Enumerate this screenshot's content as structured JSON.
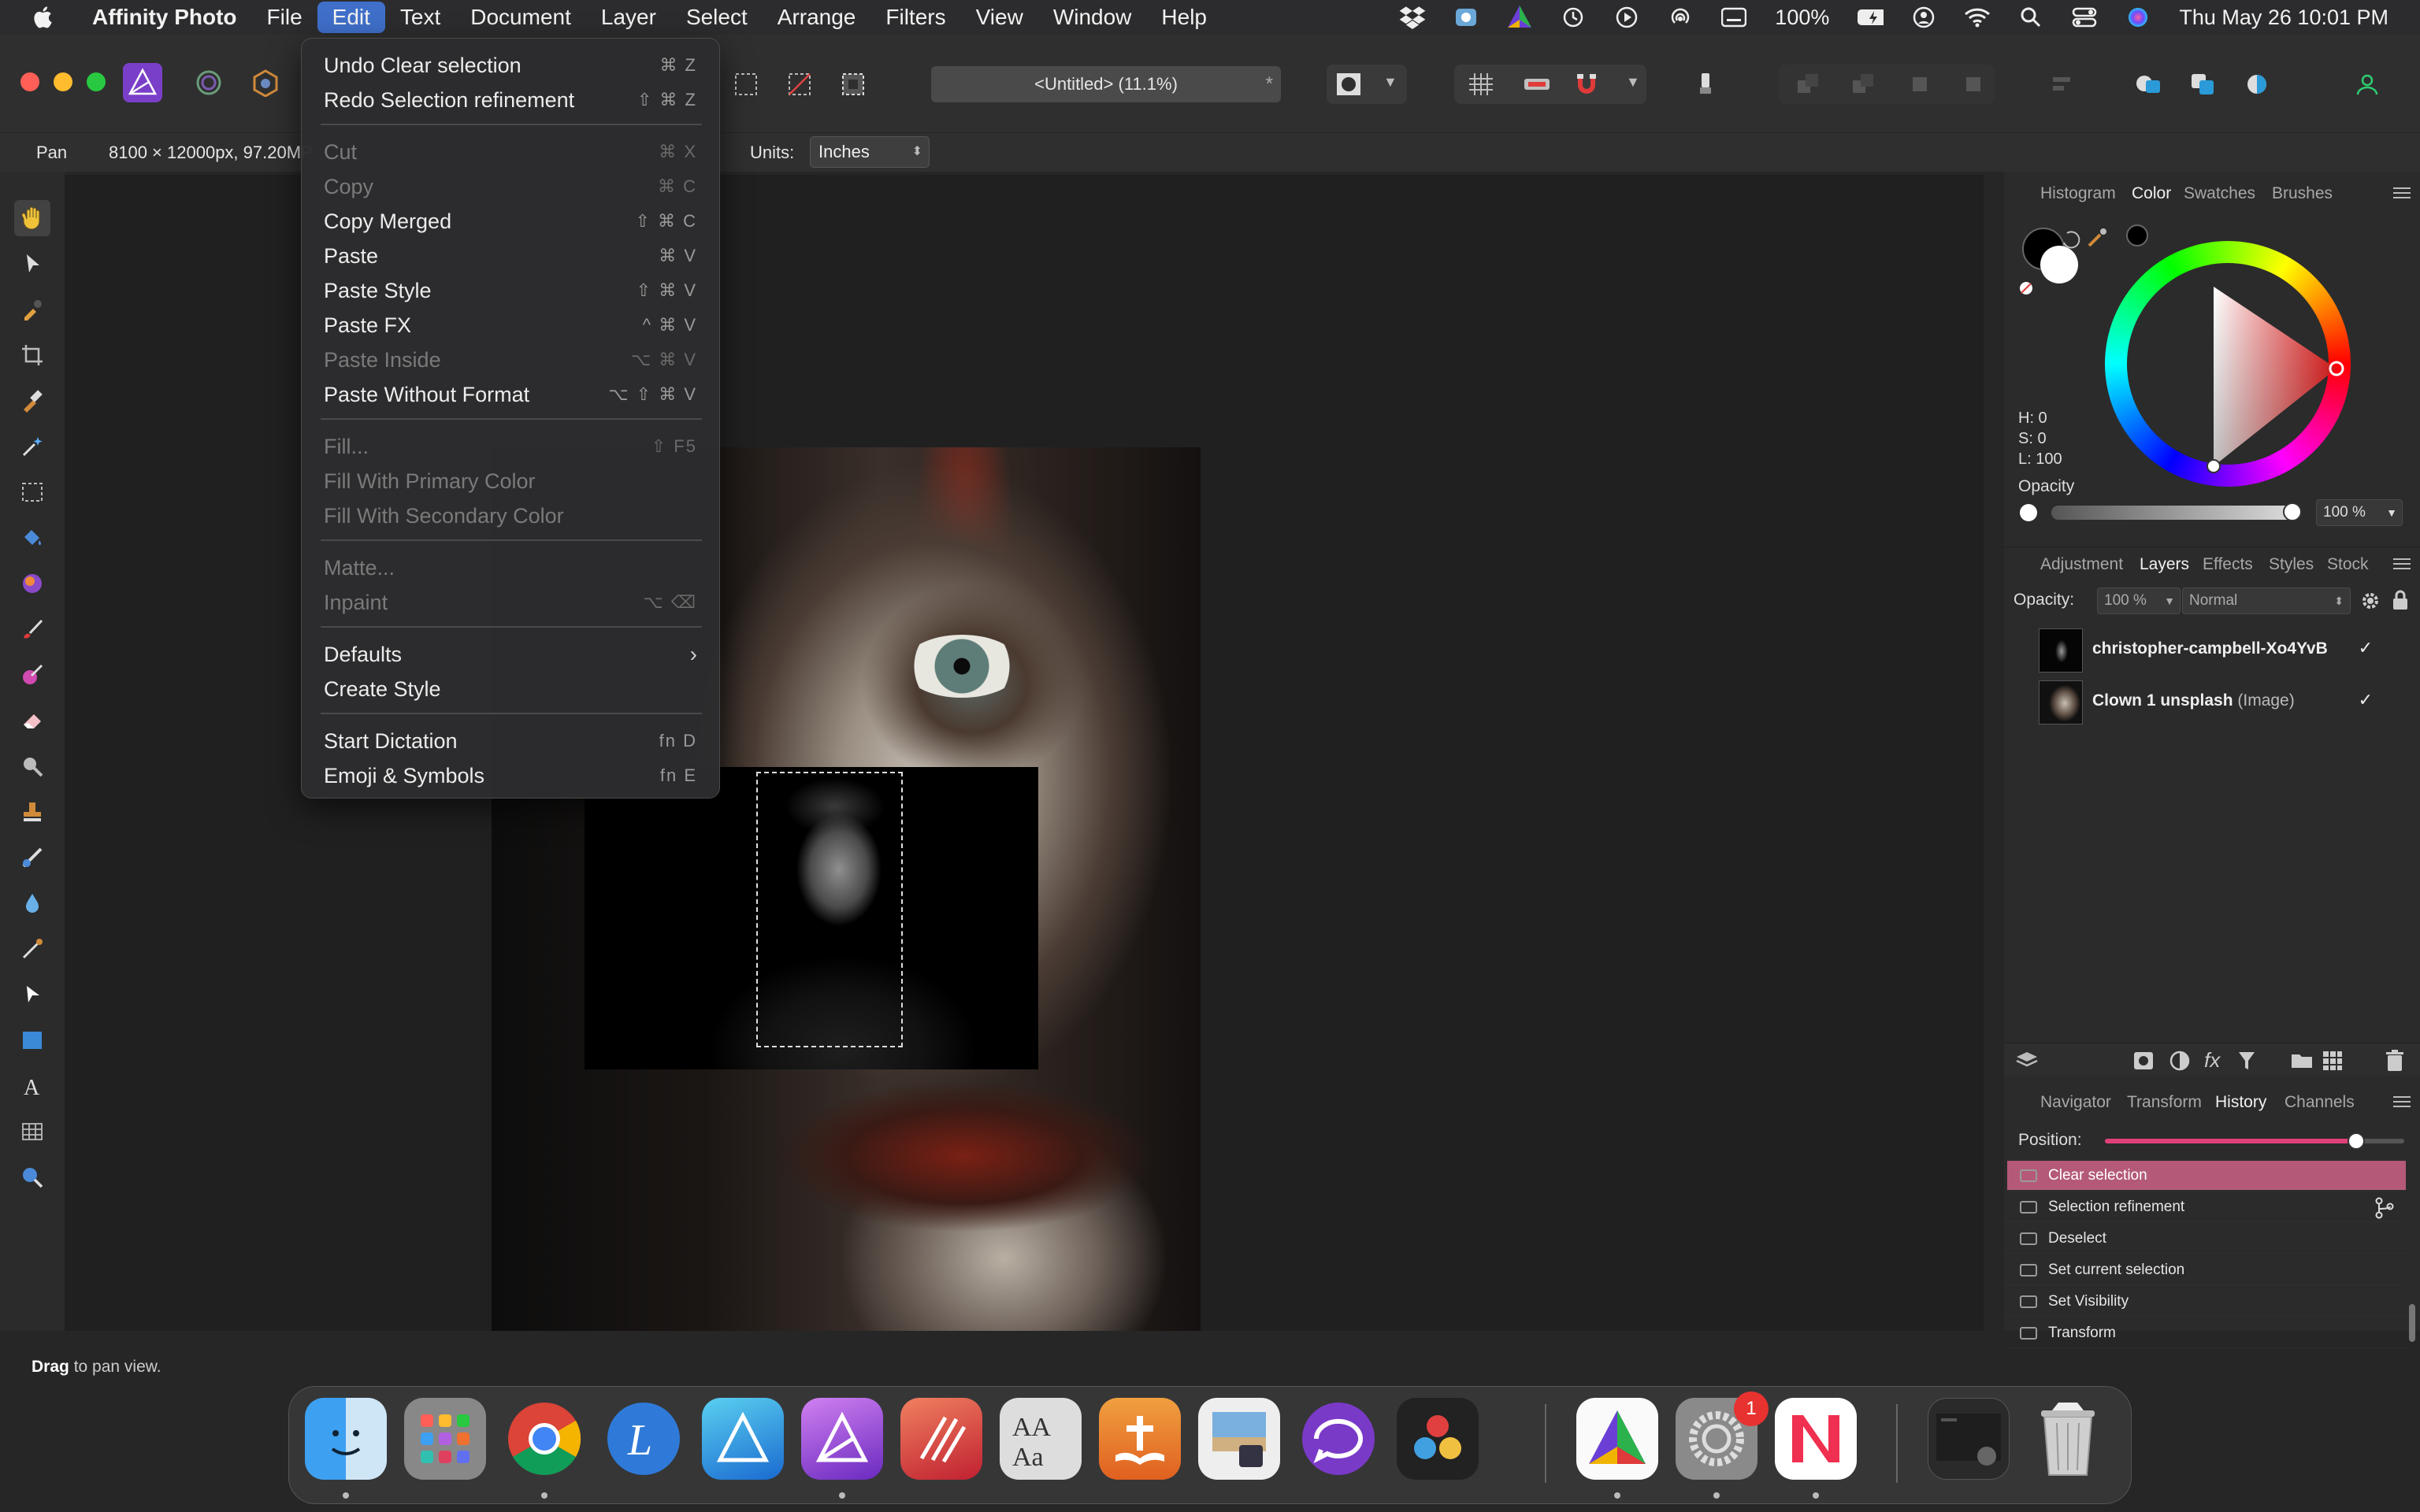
{
  "menubar": {
    "app_name": "Affinity Photo",
    "items": [
      "File",
      "Edit",
      "Text",
      "Document",
      "Layer",
      "Select",
      "Arrange",
      "Filters",
      "View",
      "Window",
      "Help"
    ],
    "battery": "100%",
    "datetime": "Thu May 26  10:01 PM"
  },
  "toolbar": {
    "document_title": "<Untitled> (11.1%)",
    "modified_mark": "*"
  },
  "context": {
    "tool": "Pan",
    "doc_size": "8100 × 12000px, 97.20MP",
    "units_label": "Units:",
    "units_value": "Inches"
  },
  "edit_menu": {
    "items": [
      {
        "label": "Undo Clear selection",
        "shortcut": "⌘ Z",
        "enabled": true
      },
      {
        "label": "Redo Selection refinement",
        "shortcut": "⇧ ⌘ Z",
        "enabled": true
      },
      {
        "label": "Cut",
        "shortcut": "⌘ X",
        "enabled": false
      },
      {
        "label": "Copy",
        "shortcut": "⌘ C",
        "enabled": false
      },
      {
        "label": "Copy Merged",
        "shortcut": "⇧ ⌘ C",
        "enabled": true
      },
      {
        "label": "Paste",
        "shortcut": "⌘ V",
        "enabled": true
      },
      {
        "label": "Paste Style",
        "shortcut": "⇧ ⌘ V",
        "enabled": true
      },
      {
        "label": "Paste FX",
        "shortcut": "^ ⌘ V",
        "enabled": true
      },
      {
        "label": "Paste Inside",
        "shortcut": "⌥ ⌘ V",
        "enabled": false
      },
      {
        "label": "Paste Without Format",
        "shortcut": "⌥ ⇧ ⌘ V",
        "enabled": true
      },
      {
        "label": "Fill...",
        "shortcut": "⇧ F5",
        "enabled": false
      },
      {
        "label": "Fill With Primary Color",
        "shortcut": "",
        "enabled": false
      },
      {
        "label": "Fill With Secondary Color",
        "shortcut": "",
        "enabled": false
      },
      {
        "label": "Matte...",
        "shortcut": "",
        "enabled": false
      },
      {
        "label": "Inpaint",
        "shortcut": "⌥ ⌫",
        "enabled": false
      },
      {
        "label": "Defaults",
        "shortcut": "",
        "enabled": true,
        "submenu": true
      },
      {
        "label": "Create Style",
        "shortcut": "",
        "enabled": true
      },
      {
        "label": "Start Dictation",
        "shortcut": "fn D",
        "enabled": true
      },
      {
        "label": "Emoji & Symbols",
        "shortcut": "fn E",
        "enabled": true
      }
    ]
  },
  "color_panel": {
    "tabs": [
      "Histogram",
      "Color",
      "Swatches",
      "Brushes"
    ],
    "active_tab": "Color",
    "h": "H: 0",
    "s": "S: 0",
    "l": "L: 100",
    "opacity_label": "Opacity",
    "opacity_value": "100 %"
  },
  "layers_panel": {
    "tabs": [
      "Adjustment",
      "Layers",
      "Effects",
      "Styles",
      "Stock"
    ],
    "active_tab": "Layers",
    "opacity_label": "Opacity:",
    "opacity_value": "100 %",
    "blend_mode": "Normal",
    "layers": [
      {
        "name": "christopher-campbell-Xo4YvB",
        "kind": "",
        "visible": "✓"
      },
      {
        "name": "Clown 1 unsplash",
        "kind": "(Image)",
        "visible": "✓"
      }
    ]
  },
  "history_panel": {
    "tabs": [
      "Navigator",
      "Transform",
      "History",
      "Channels"
    ],
    "active_tab": "History",
    "position_label": "Position:",
    "position_fraction": 0.84,
    "items": [
      "Clear selection",
      "Selection refinement",
      "Deselect",
      "Set current selection",
      "Set Visibility",
      "Transform"
    ]
  },
  "status": {
    "bold": "Drag",
    "text": " to pan view."
  },
  "dock": {
    "badge_count": "1"
  },
  "colors": {
    "menu_highlight": "#3f6fc9",
    "history_selected": "#b45a78",
    "history_slider": "#e0407a"
  }
}
